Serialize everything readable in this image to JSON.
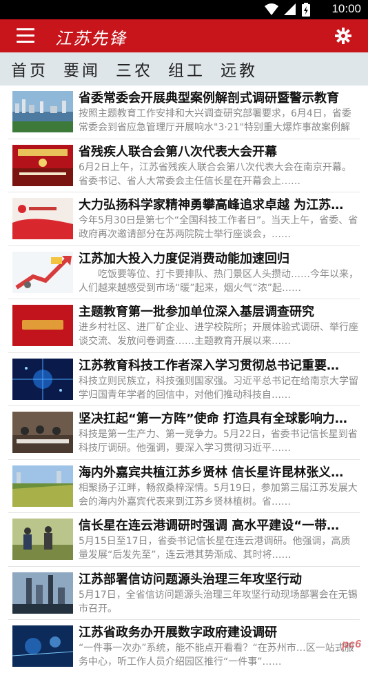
{
  "status": {
    "time": "10:00"
  },
  "app": {
    "logo_text": "江苏先锋"
  },
  "tabs": [
    "首页",
    "要闻",
    "三农",
    "组工",
    "远教"
  ],
  "news": [
    {
      "title": "省委常委会开展典型案例解剖式调研暨警示教育",
      "summary": "按照主题教育工作安排和大兴调查研究部署要求，6月4日，省委常委会到省应急管理厅开展响水\"3·21\"特别重大爆炸事故案例解剖式调研……"
    },
    {
      "title": "省残疾人联合会第八次代表大会开幕",
      "summary": "6月2日上午，江苏省残疾人联合会第八次代表大会在南京开幕。省委书记、省人大常委会主任信长星在开幕会上……"
    },
    {
      "title": "大力弘扬科学家精神勇攀高峰追求卓越 为江苏…",
      "summary": "今年5月30日是第七个“全国科技工作者日”。当天上午，省委、省政府再次邀请部分在苏两院院士举行座谈会，……"
    },
    {
      "title": "江苏加大投入力度促消费动能加速回归",
      "summary": "　　吃饭要等位、打卡要排队、热门景区人头攒动……今年以来，人们越来越感受到市场“暖”起来，烟火气“浓”起……"
    },
    {
      "title": "主题教育第一批参加单位深入基层调查研究",
      "summary": "进乡村社区、进厂矿企业、进学校院所；开展体验式调研、举行座谈交流、发放问卷调查……主题教育开展以来……"
    },
    {
      "title": "江苏教育科技工作者深入学习贯彻总书记重要…",
      "summary": "科技立则民族立，科技强则国家强。习近平总书记在给南京大学留学归国青年学者的回信中，对他们推动科技自……"
    },
    {
      "title": "坚决扛起“第一方阵”使命 打造具有全球影响力…",
      "summary": "科技是第一生产力、第一竞争力。5月22日，省委书记信长星到省科技厅调研。他强调，要深入学习贯彻习近平……"
    },
    {
      "title": "海内外嘉宾共植江苏乡贤林 信长星许昆林张义…",
      "summary": "相聚扬子江畔，畅叙桑梓深情。5月19日，参加第三届江苏发展大会的海内外嘉宾代表来到江苏乡贤林植树。省……"
    },
    {
      "title": "信长星在连云港调研时强调 高水平建设“一带…",
      "summary": "5月15日至17日，省委书记信长星在连云港调研。他强调，高质量发展“后发先至”，连云港其势渐成、其时将……"
    },
    {
      "title": "江苏部署信访问题源头治理三年攻坚行动",
      "summary": "5月17日，全省信访问题源头治理三年攻坚行动现场部署会在无锡市召开。"
    },
    {
      "title": "江苏省政务办开展数字政府建设调研",
      "summary": "“一件事一次办”系统，能不能点开看看？“在苏州市…区一站式服务中心，听工作人员介绍园区推行“一件事”……"
    }
  ],
  "watermark": "pc6"
}
